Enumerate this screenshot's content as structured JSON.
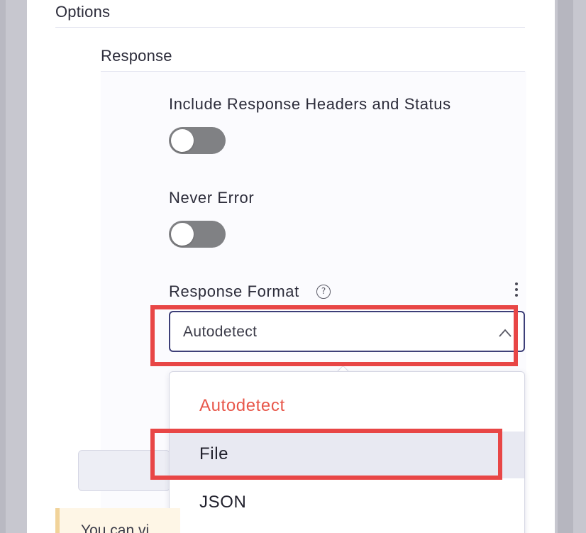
{
  "options": {
    "title": "Options"
  },
  "response_section": {
    "title": "Response",
    "include_headers": {
      "label": "Include Response Headers and Status",
      "enabled": false
    },
    "never_error": {
      "label": "Never Error",
      "enabled": false
    },
    "response_format": {
      "label": "Response Format",
      "help_icon": "question-circle-icon",
      "menu_icon": "kebab-icon",
      "selected": "Autodetect",
      "dropdown_open": true,
      "options": [
        "Autodetect",
        "File",
        "JSON"
      ],
      "hovered_option": "File"
    }
  },
  "notice": {
    "text": "You can vi"
  },
  "colors": {
    "highlight": "#e84646",
    "selected_option": "#e8574a",
    "select_border": "#3d3f78",
    "toggle_off": "#808184"
  }
}
